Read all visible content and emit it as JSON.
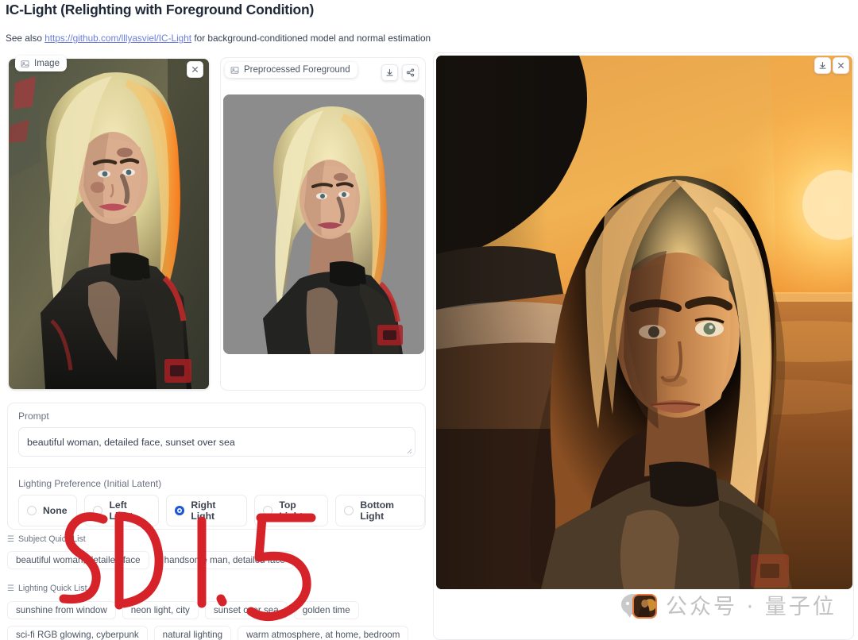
{
  "header": {
    "title": "IC-Light (Relighting with Foreground Condition)",
    "subtitle_before": "See also ",
    "link_text": "https://github.com/lllyasviel/IC-Light",
    "subtitle_after": " for background-conditioned model and normal estimation",
    "link_color": "#6b7ddb"
  },
  "panels": {
    "input": {
      "chip_label": "Image",
      "chip_icon": "image-icon",
      "close_icon": "close-icon"
    },
    "foreground": {
      "chip_label": "Preprocessed Foreground",
      "chip_icon": "image-icon",
      "download_icon": "download-icon",
      "share_icon": "share-icon"
    },
    "output": {
      "download_icon": "download-icon",
      "close_icon": "close-icon"
    }
  },
  "settings": {
    "prompt_label": "Prompt",
    "prompt_value": "beautiful woman, detailed face, sunset over sea",
    "prompt_placeholder": "",
    "lighting_label": "Lighting Preference (Initial Latent)",
    "lighting_options": [
      {
        "label": "None",
        "selected": false
      },
      {
        "label": "Left Light",
        "selected": false
      },
      {
        "label": "Right Light",
        "selected": true
      },
      {
        "label": "Top Light",
        "selected": false
      },
      {
        "label": "Bottom Light",
        "selected": false
      }
    ],
    "selected_lighting": "Right Light",
    "accent_color": "#1f56d6"
  },
  "subject_quick_list": {
    "heading": "Subject Quick List",
    "menu_icon": "list-icon",
    "tags": [
      "beautiful woman, detailed face",
      "handsome man, detailed face"
    ]
  },
  "lighting_quick_list": {
    "heading": "Lighting Quick List",
    "menu_icon": "list-icon",
    "row1": [
      "sunshine from window",
      "neon light, city",
      "sunset over sea",
      "golden time"
    ],
    "row2": [
      "sci-fi RGB glowing, cyberpunk",
      "natural lighting",
      "warm atmosphere, at home, bedroom"
    ]
  },
  "annotation": {
    "text": "SD1.5",
    "color": "#d6232a",
    "style": "handwritten-marker"
  },
  "watermark": {
    "text": "公众号 · 量子位",
    "bubble_icon": "chat-bubble-icon",
    "avatar_icon": "avatar",
    "color": "#c2c2c2"
  }
}
